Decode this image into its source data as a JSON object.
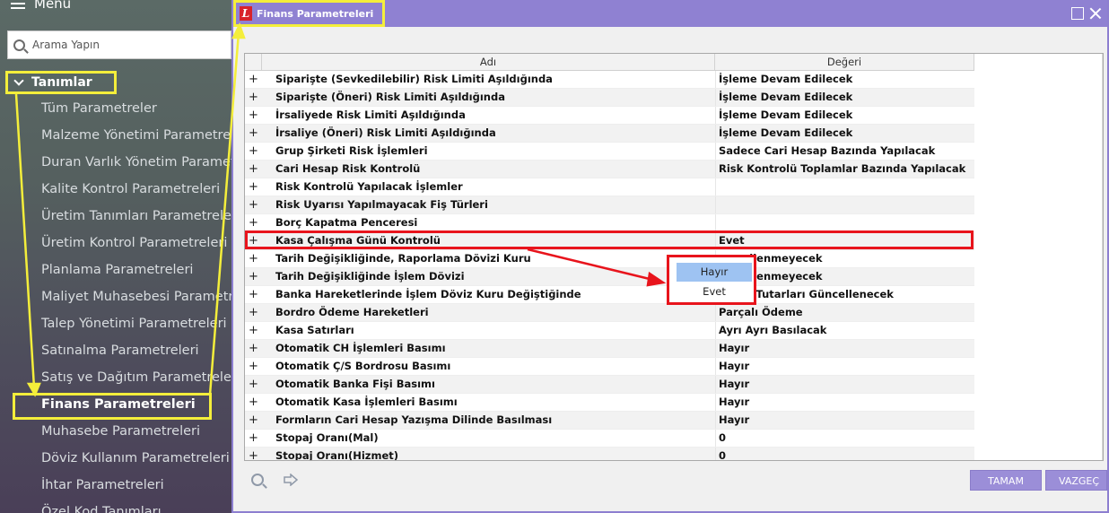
{
  "sidebar": {
    "menu_label": "Menu",
    "search_placeholder": "Arama Yapın",
    "section_label": "Tanımlar",
    "items": [
      {
        "label": "Tüm Parametreler"
      },
      {
        "label": "Malzeme Yönetimi Parametreleri"
      },
      {
        "label": "Duran Varlık Yönetim Parametreleri"
      },
      {
        "label": "Kalite Kontrol Parametreleri"
      },
      {
        "label": "Üretim Tanımları Parametreleri"
      },
      {
        "label": "Üretim Kontrol Parametreleri"
      },
      {
        "label": "Planlama Parametreleri"
      },
      {
        "label": "Maliyet Muhasebesi Parametreleri"
      },
      {
        "label": "Talep Yönetimi Parametreleri"
      },
      {
        "label": "Satınalma Parametreleri"
      },
      {
        "label": "Satış ve Dağıtım Parametreleri"
      },
      {
        "label": "Finans Parametreleri",
        "active": true
      },
      {
        "label": "Muhasebe Parametreleri"
      },
      {
        "label": "Döviz Kullanım Parametreleri"
      },
      {
        "label": "İhtar Parametreleri"
      },
      {
        "label": "Özel Kod Tanımları"
      }
    ]
  },
  "dialog": {
    "title": "Finans Parametreleri",
    "logo_letter": "L",
    "columns": {
      "name": "Adı",
      "value": "Değeri"
    },
    "rows": [
      {
        "expander": "+",
        "name": "Siparişte (Sevkedilebilir) Risk Limiti Aşıldığında",
        "value": "İşleme Devam Edilecek"
      },
      {
        "expander": "+",
        "name": "Siparişte (Öneri) Risk Limiti Aşıldığında",
        "value": "İşleme Devam Edilecek"
      },
      {
        "expander": "+",
        "name": "İrsaliyede Risk Limiti Aşıldığında",
        "value": "İşleme Devam Edilecek"
      },
      {
        "expander": "+",
        "name": "İrsaliye (Öneri) Risk Limiti Aşıldığında",
        "value": "İşleme Devam Edilecek"
      },
      {
        "expander": "+",
        "name": "Grup Şirketi Risk İşlemleri",
        "value": "Sadece Cari Hesap Bazında Yapılacak"
      },
      {
        "expander": "+",
        "name": "Cari Hesap Risk Kontrolü",
        "value": "Risk Kontrolü Toplamlar Bazında Yapılacak"
      },
      {
        "expander": "+",
        "name": "Risk Kontrolü Yapılacak İşlemler",
        "value": ""
      },
      {
        "expander": "+",
        "name": "Risk Uyarısı Yapılmayacak Fiş Türleri",
        "value": ""
      },
      {
        "expander": "+",
        "name": "Borç Kapatma Penceresi",
        "value": ""
      },
      {
        "expander": "+",
        "name": "Kasa Çalışma Günü Kontrolü",
        "value": "Evet"
      },
      {
        "expander": "+",
        "name": "Tarih Değişikliğinde, Raporlama Dövizi Kuru",
        "value": "…ncellenmeyecek"
      },
      {
        "expander": "+",
        "name": "Tarih Değişikliğinde İşlem Dövizi",
        "value": "…ncellenmeyecek"
      },
      {
        "expander": "+",
        "name": "Banka Hareketlerinde İşlem Döviz Kuru Değiştiğinde",
        "value": "…öviz Tutarları Güncellenecek"
      },
      {
        "expander": "+",
        "name": "Bordro Ödeme Hareketleri",
        "value": "Parçalı Ödeme"
      },
      {
        "expander": "+",
        "name": "Kasa Satırları",
        "value": "Ayrı Ayrı Basılacak"
      },
      {
        "expander": "+",
        "name": "Otomatik CH İşlemleri Basımı",
        "value": "Hayır"
      },
      {
        "expander": "+",
        "name": "Otomatik Ç/S Bordrosu Basımı",
        "value": "Hayır"
      },
      {
        "expander": "+",
        "name": "Otomatik Banka Fişi Basımı",
        "value": "Hayır"
      },
      {
        "expander": "+",
        "name": "Otomatik Kasa İşlemleri Basımı",
        "value": "Hayır"
      },
      {
        "expander": "+",
        "name": "Formların Cari Hesap Yazışma Dilinde Basılması",
        "value": "Hayır"
      },
      {
        "expander": "+",
        "name": "Stopaj Oranı(Mal)",
        "value": "0"
      },
      {
        "expander": "+",
        "name": "Stopaj Oranı(Hizmet)",
        "value": "0"
      }
    ],
    "dropdown_options": [
      "Hayır",
      "Evet"
    ],
    "buttons": {
      "ok": "TAMAM",
      "cancel": "VAZGEÇ"
    }
  },
  "colors": {
    "titlebar": "#8f81d2",
    "highlight_yellow": "#f4ee3b",
    "highlight_red": "#e8141c",
    "selected_option": "#9ec3f2"
  }
}
